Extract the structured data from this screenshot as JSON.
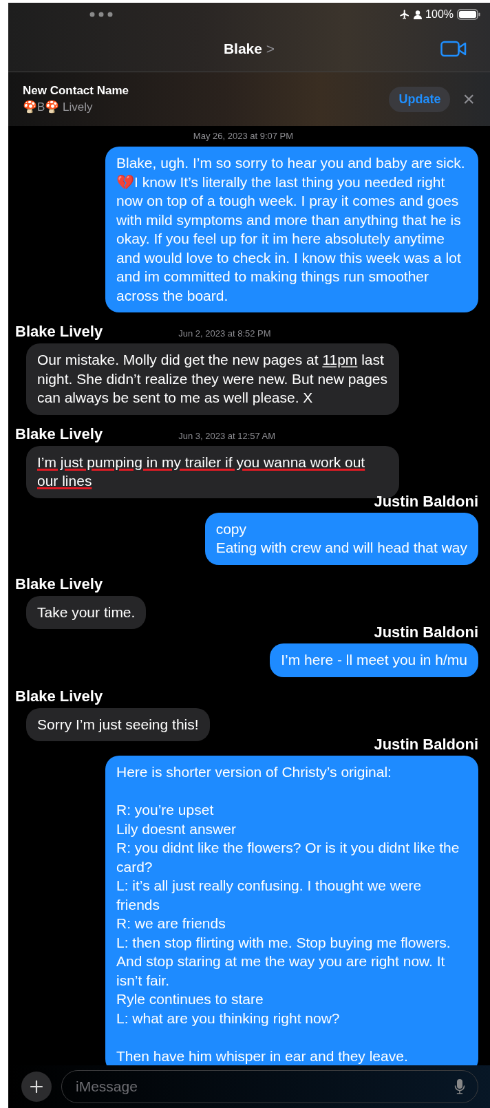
{
  "status_bar": {
    "battery": "100%"
  },
  "header": {
    "title": "Blake",
    "chevron": ">"
  },
  "banner": {
    "label": "New Contact Name",
    "name": "🍄B🍄 Lively",
    "button": "Update",
    "close": "×"
  },
  "items": [
    {
      "kind": "time",
      "time": "May 26, 2023 at 9:07 PM"
    },
    {
      "kind": "sent",
      "underlined": false,
      "parts": [
        {
          "kind": "text",
          "text": "Blake, ugh. I’m so sorry to hear you and baby are sick. 💔I know It’s literally the last thing you needed right now on top of a tough week. I pray it comes and goes with mild symptoms and more than anything that he is okay. If you feel up for it im here absolutely anytime and would love to check in. I know this week was a lot and im committed to making things run smoother across the board."
        }
      ]
    },
    {
      "kind": "received_name",
      "name": "Blake Lively",
      "time": "Jun 2, 2023 at 8:52 PM"
    },
    {
      "kind": "received",
      "underlined": false,
      "parts": [
        {
          "kind": "text",
          "text": "Our mistake. Molly did get the new pages at "
        },
        {
          "kind": "link",
          "text": "11pm"
        },
        {
          "kind": "text",
          "text": " last night. She didn’t realize they were new. But new pages can always be sent to me as well please. X"
        }
      ]
    },
    {
      "kind": "received_name",
      "name": "Blake Lively",
      "time": "Jun 3, 2023 at 12:57 AM"
    },
    {
      "kind": "received",
      "underlined": true,
      "parts": [
        {
          "kind": "text",
          "text": "I’m just pumping in my trailer if you wanna work out our lines"
        }
      ]
    },
    {
      "kind": "sent_name",
      "name": "Justin Baldoni"
    },
    {
      "kind": "sent",
      "underlined": false,
      "parts": [
        {
          "kind": "text",
          "text": "copy\nEating with crew and will head that way"
        }
      ]
    },
    {
      "kind": "received_name",
      "name": "Blake Lively"
    },
    {
      "kind": "received",
      "underlined": false,
      "parts": [
        {
          "kind": "text",
          "text": "Take your time."
        }
      ]
    },
    {
      "kind": "sent_name",
      "name": "Justin Baldoni"
    },
    {
      "kind": "sent",
      "underlined": false,
      "parts": [
        {
          "kind": "text",
          "text": "I’m here - ll meet you in h/mu"
        }
      ]
    },
    {
      "kind": "received_name",
      "name": "Blake Lively"
    },
    {
      "kind": "received",
      "underlined": false,
      "parts": [
        {
          "kind": "text",
          "text": "Sorry I’m just seeing this!"
        }
      ]
    },
    {
      "kind": "sent_name",
      "name": "Justin Baldoni"
    },
    {
      "kind": "sent",
      "underlined": false,
      "parts": [
        {
          "kind": "text",
          "text": "Here is shorter version of Christy’s original:\n\nR: you’re upset\nLily doesnt answer\nR: you didnt like the flowers? Or is it you didnt like the card?\nL: it’s all just really confusing. I thought we were friends\nR: we are friends\nL: then stop flirting with me. Stop buying me flowers. And stop staring at me the way you are right now. It isn’t fair.\nRyle continues to stare\nL: what are you thinking right now?\n\nThen have him whisper in ear and they leave."
        }
      ]
    }
  ],
  "composer": {
    "placeholder": "iMessage"
  }
}
